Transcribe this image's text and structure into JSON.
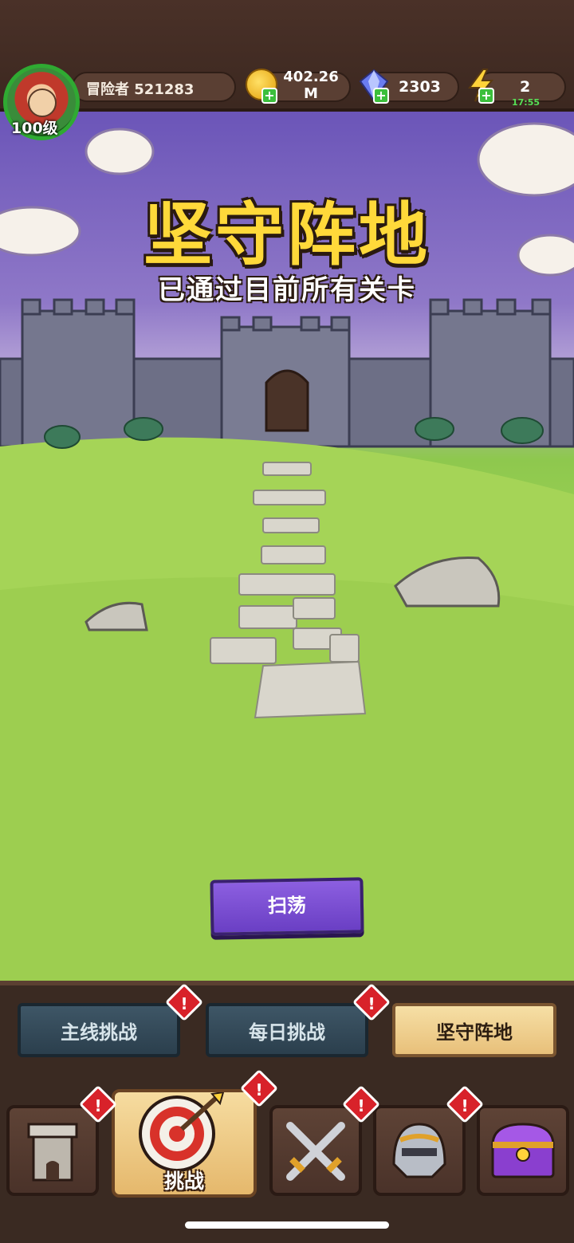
{
  "player": {
    "name": "冒险者 521283",
    "level": "100级"
  },
  "resources": {
    "coins": {
      "value": "402.26",
      "unit": "M",
      "icon": "coin-icon"
    },
    "gems": {
      "value": "2303",
      "icon": "gem-icon"
    },
    "energy": {
      "value": "2",
      "timer": "17:55",
      "icon": "lightning-icon"
    },
    "plus": "+"
  },
  "stage": {
    "title": "坚守阵地",
    "subtitle": "已通过目前所有关卡",
    "sweep_label": "扫荡"
  },
  "tabs": [
    {
      "label": "主线挑战",
      "alert": true,
      "active": false
    },
    {
      "label": "每日挑战",
      "alert": true,
      "active": false
    },
    {
      "label": "坚守阵地",
      "alert": false,
      "active": true
    }
  ],
  "nav": {
    "items": [
      {
        "icon": "tower-icon",
        "alert": true
      },
      {
        "icon": "target-icon",
        "label": "挑战",
        "alert": true,
        "active": true
      },
      {
        "icon": "crossed-swords-icon",
        "alert": true
      },
      {
        "icon": "helmet-icon",
        "alert": true
      },
      {
        "icon": "treasure-chest-icon",
        "alert": false
      }
    ]
  },
  "alert_mark": "!",
  "colors": {
    "title": "#ffd93a",
    "sweep": "#7b4fd6",
    "alert": "#d8222a",
    "active_tab": "#f3d798",
    "energy_timer": "#56e056"
  }
}
